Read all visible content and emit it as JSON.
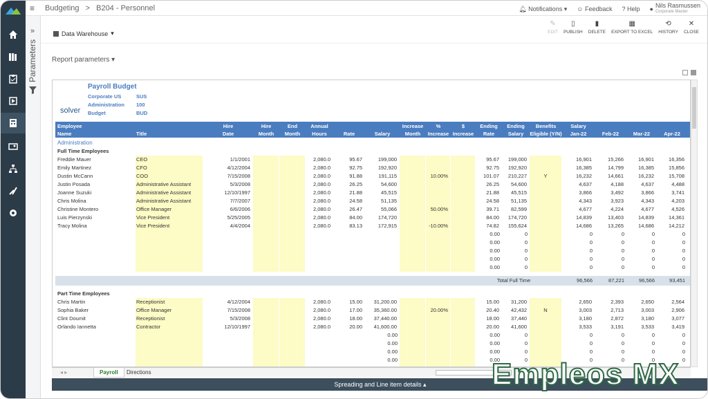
{
  "app": {
    "breadcrumb_root": "Budgeting",
    "breadcrumb_page": "B204 - Personnel"
  },
  "topbar": {
    "notifications": "Notifications",
    "feedback": "Feedback",
    "help": "Help",
    "user_name": "Nils Rasmussen",
    "user_sub": "Corporate Master"
  },
  "toolbar": {
    "data_warehouse": "Data Warehouse",
    "actions": [
      "EDIT",
      "PUBLISH",
      "DELETE",
      "EXPORT TO EXCEL",
      "HISTORY",
      "CLOSE"
    ]
  },
  "params": {
    "label": "Parameters"
  },
  "report": {
    "parameters_label": "Report parameters",
    "title": "Payroll Budget",
    "logo": "solver",
    "meta": [
      [
        "Corporate US",
        "SUS"
      ],
      [
        "Administration",
        "100"
      ],
      [
        "Budget",
        "BUD"
      ]
    ]
  },
  "columns": [
    [
      "Employee",
      "Name"
    ],
    [
      "",
      "Title"
    ],
    [
      "Hire",
      "Date"
    ],
    [
      "Hire",
      "Month"
    ],
    [
      "End",
      "Month"
    ],
    [
      "Annual",
      "Hours"
    ],
    [
      "",
      "Rate"
    ],
    [
      "",
      "Salary"
    ],
    [
      "Increase",
      "Month"
    ],
    [
      "%",
      "Increase"
    ],
    [
      "$",
      "Increase"
    ],
    [
      "Ending",
      "Rate"
    ],
    [
      "Ending",
      "Salary"
    ],
    [
      "Benefits",
      "Eligible (Y/N)"
    ],
    [
      "Salary",
      "Jan-22"
    ],
    [
      "",
      "Feb-22"
    ],
    [
      "",
      "Mar-22"
    ],
    [
      "",
      "Apr-22"
    ]
  ],
  "section_admin": "Administration",
  "group_fulltime": "Full Time Employees",
  "fulltime": [
    [
      "Freddie Mauer",
      "CEO",
      "1/1/2001",
      "2,080.0",
      "95.67",
      "199,000",
      "",
      "95.67",
      "199,000",
      "",
      "16,901",
      "15,266",
      "16,901",
      "16,356"
    ],
    [
      "Emily Martinez",
      "CFO",
      "4/12/2004",
      "2,080.0",
      "92.75",
      "192,920",
      "",
      "92.75",
      "192,920",
      "",
      "16,385",
      "14,799",
      "16,385",
      "15,856"
    ],
    [
      "Dustin McCann",
      "COO",
      "7/15/2008",
      "2,080.0",
      "91.88",
      "191,115",
      "10.00%",
      "101.07",
      "210,227",
      "Y",
      "16,232",
      "14,661",
      "16,232",
      "15,708"
    ],
    [
      "Justin Posada",
      "Administrative Assistant",
      "5/3/2008",
      "2,080.0",
      "26.25",
      "54,600",
      "",
      "26.25",
      "54,600",
      "",
      "4,637",
      "4,188",
      "4,637",
      "4,488"
    ],
    [
      "Joanne Suzuki",
      "Administrative Assistant",
      "12/10/1997",
      "2,080.0",
      "21.88",
      "45,515",
      "",
      "21.88",
      "45,515",
      "",
      "3,866",
      "3,492",
      "3,866",
      "3,741"
    ],
    [
      "Chris Molina",
      "Administrative Assistant",
      "7/7/2007",
      "2,080.0",
      "24.58",
      "51,135",
      "",
      "24.58",
      "51,135",
      "",
      "4,343",
      "3,923",
      "4,343",
      "4,203"
    ],
    [
      "Christine Montero",
      "Office Manager",
      "6/6/2006",
      "2,080.0",
      "26.47",
      "55,066",
      "50.00%",
      "39.71",
      "82,599",
      "",
      "4,677",
      "4,224",
      "4,677",
      "4,526"
    ],
    [
      "Luis Pierzynski",
      "Vice President",
      "5/25/2005",
      "2,080.0",
      "84.00",
      "174,720",
      "",
      "84.00",
      "174,720",
      "",
      "14,839",
      "13,403",
      "14,839",
      "14,361"
    ],
    [
      "Tracy Molina",
      "Vice President",
      "4/4/2004",
      "2,080.0",
      "83.13",
      "172,915",
      "-10.00%",
      "74.82",
      "155,624",
      "",
      "14,686",
      "13,265",
      "14,686",
      "14,212"
    ]
  ],
  "empty_row": [
    "0.00",
    "0",
    "0",
    "0",
    "0",
    "0"
  ],
  "total_fulltime": {
    "label": "Total Full Time",
    "values": [
      "96,566",
      "87,221",
      "96,566",
      "93,451"
    ]
  },
  "group_parttime": "Part Time Employees",
  "parttime": [
    [
      "Chris Martin",
      "Receptionist",
      "4/12/2004",
      "2,080.0",
      "15.00",
      "31,200.00",
      "",
      "15.00",
      "31,200",
      "",
      "2,650",
      "2,393",
      "2,650",
      "2,564"
    ],
    [
      "Sophia Baker",
      "Office Manager",
      "7/15/2008",
      "2,080.0",
      "17.00",
      "35,360.00",
      "20.00%",
      "20.40",
      "42,432",
      "N",
      "3,003",
      "2,713",
      "3,003",
      "2,906"
    ],
    [
      "Clint Doumit",
      "Receptionist",
      "5/3/2008",
      "2,080.0",
      "18.00",
      "37,440.00",
      "",
      "18.00",
      "37,440",
      "",
      "3,180",
      "2,872",
      "3,180",
      "3,077"
    ],
    [
      "Orlando Iannetta",
      "Contractor",
      "12/10/1997",
      "2,080.0",
      "20.00",
      "41,600.00",
      "",
      "20.00",
      "41,600",
      "",
      "3,533",
      "3,191",
      "3,533",
      "3,419"
    ]
  ],
  "empty_row_pt": [
    "0.00",
    "0.00",
    "0",
    "0",
    "0",
    "0",
    "0"
  ],
  "tabs": {
    "payroll": "Payroll",
    "directions": "Directions"
  },
  "bottom": {
    "label": "Spreading and Line item details"
  },
  "watermark": "Empleos MX"
}
